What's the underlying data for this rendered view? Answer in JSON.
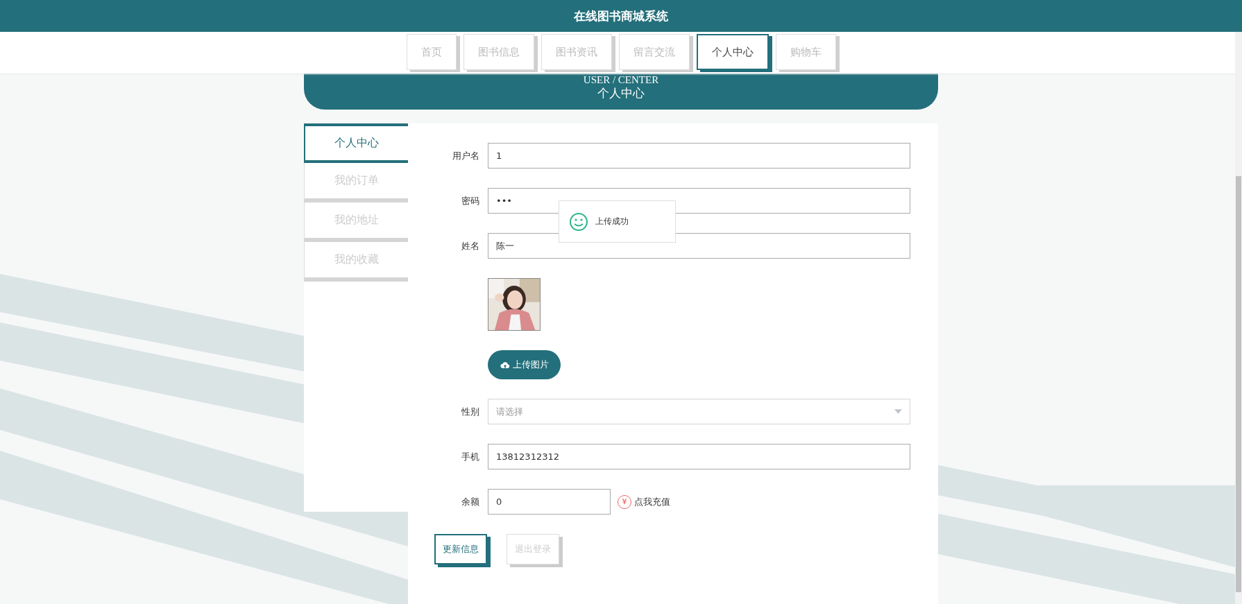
{
  "header": {
    "title": "在线图书商城系统"
  },
  "nav": [
    {
      "label": "首页",
      "selected": false
    },
    {
      "label": "图书信息",
      "selected": false
    },
    {
      "label": "图书资讯",
      "selected": false
    },
    {
      "label": "留言交流",
      "selected": false
    },
    {
      "label": "个人中心",
      "selected": true
    },
    {
      "label": "购物车",
      "selected": false
    }
  ],
  "banner": {
    "subtitle": "USER / CENTER",
    "title": "个人中心"
  },
  "sidebar": [
    {
      "label": "个人中心",
      "selected": true
    },
    {
      "label": "我的订单",
      "selected": false
    },
    {
      "label": "我的地址",
      "selected": false
    },
    {
      "label": "我的收藏",
      "selected": false
    }
  ],
  "form": {
    "fields": [
      {
        "kind": "text",
        "label": "用户名",
        "value": "1"
      },
      {
        "kind": "text",
        "label": "密码",
        "value": "•••"
      },
      {
        "kind": "text",
        "label": "姓名",
        "value": "陈一"
      },
      {
        "kind": "avatar",
        "button": "上传图片"
      },
      {
        "kind": "select",
        "label": "性别",
        "placeholder": "请选择"
      },
      {
        "kind": "text",
        "label": "手机",
        "value": "13812312312"
      },
      {
        "kind": "balance",
        "label": "余额",
        "value": "0",
        "link_icon": "¥",
        "link": "点我充值"
      }
    ],
    "buttons": [
      {
        "kind": "primary",
        "label": "更新信息"
      },
      {
        "kind": "secondary",
        "label": "退出登录"
      }
    ]
  },
  "toast": {
    "message": "上传成功"
  }
}
